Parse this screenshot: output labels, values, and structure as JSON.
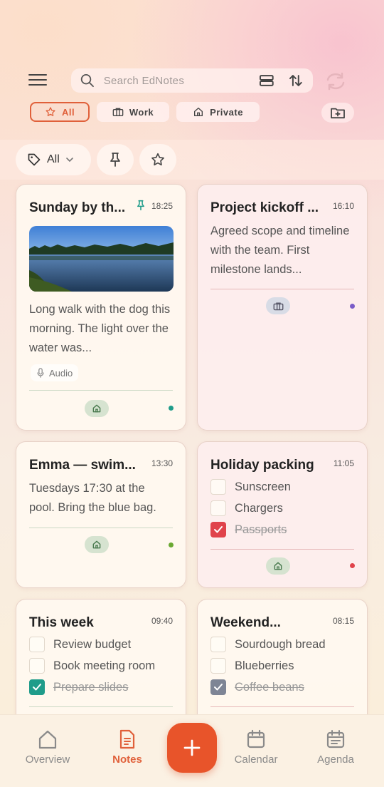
{
  "header": {
    "search_placeholder": "Search EdNotes",
    "icons": [
      "menu-icon",
      "search-icon",
      "view-toggle-icon",
      "sort-icon",
      "sync-icon"
    ]
  },
  "filters": {
    "chips": [
      {
        "label": "All",
        "icon": "star-icon",
        "active": true
      },
      {
        "label": "Work",
        "icon": "briefcase-icon",
        "active": false
      },
      {
        "label": "Private",
        "icon": "home-icon",
        "active": false
      }
    ],
    "tag_filter_label": "All"
  },
  "colors": {
    "accent": "#e0603a",
    "fab": "#e8542a",
    "teal": "#1f9c8a",
    "red": "#e0434b",
    "purple": "#7a5cc8",
    "green": "#6aa832"
  },
  "notes": [
    {
      "title": "Sunday by th...",
      "time": "18:25",
      "pinned": true,
      "body": "Long walk with the dog this morning. The light over the water was...",
      "attachment": "Audio",
      "tag_icon": "home-icon",
      "dot_color": "#1f9c8a"
    },
    {
      "title": "Project kickoff ...",
      "time": "16:10",
      "body": "Agreed scope and timeline with the team. First milestone lands...",
      "tag_icon": "briefcase-icon",
      "dot_color": "#7a5cc8"
    },
    {
      "title": "Emma — swim...",
      "time": "13:30",
      "body": "Tuesdays 17:30 at the pool. Bring the blue bag.",
      "tag_icon": "home-icon",
      "dot_color": "#6aa832"
    },
    {
      "title": "Holiday packing",
      "time": "11:05",
      "items": [
        {
          "text": "Sunscreen",
          "done": false
        },
        {
          "text": "Chargers",
          "done": false
        },
        {
          "text": "Passports",
          "done": true
        }
      ],
      "tag_icon": "home-icon",
      "dot_color": "#e0434b"
    },
    {
      "title": "This week",
      "time": "09:40",
      "items": [
        {
          "text": "Review budget",
          "done": false
        },
        {
          "text": "Book meeting room",
          "done": false
        },
        {
          "text": "Prepare slides",
          "done": true
        }
      ]
    },
    {
      "title": "Weekend...",
      "time": "08:15",
      "items": [
        {
          "text": "Sourdough bread",
          "done": false
        },
        {
          "text": "Blueberries",
          "done": false
        },
        {
          "text": "Coffee beans",
          "done": true
        }
      ]
    }
  ],
  "nav": {
    "items": [
      {
        "label": "Overview",
        "icon": "home-icon",
        "active": false
      },
      {
        "label": "Notes",
        "icon": "document-icon",
        "active": true
      },
      {
        "label": "Calendar",
        "icon": "calendar-icon",
        "active": false
      },
      {
        "label": "Agenda",
        "icon": "agenda-icon",
        "active": false
      }
    ],
    "fab_icon": "plus-icon"
  }
}
